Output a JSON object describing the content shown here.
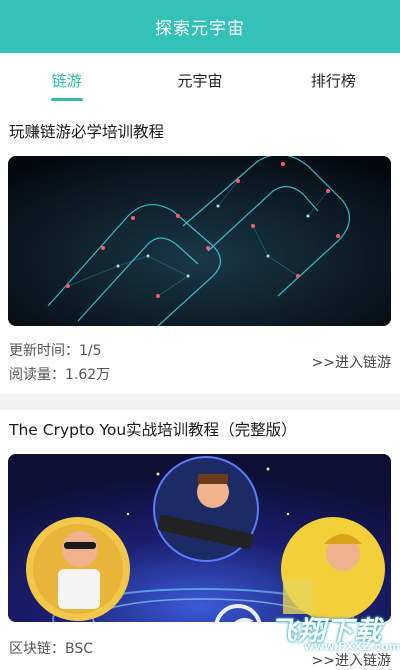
{
  "header": {
    "title": "探索元宇宙"
  },
  "tabs": [
    {
      "label": "链游",
      "active": true
    },
    {
      "label": "元宇宙",
      "active": false
    },
    {
      "label": "排行榜",
      "active": false
    }
  ],
  "cards": [
    {
      "title": "玩赚链游必学培训教程",
      "meta": [
        {
          "label": "更新时间：",
          "value": "1/5"
        },
        {
          "label": "阅读量：",
          "value": "1.62万"
        }
      ],
      "enter_label": ">>进入链游"
    },
    {
      "title": "The Crypto You实战培训教程（完整版）",
      "meta": [
        {
          "label": "区块链：",
          "value": "BSC"
        }
      ],
      "enter_label": ">>进入链游"
    }
  ],
  "watermark": {
    "text": "飞翔下载",
    "url": "www.FXXZ.com"
  },
  "colors": {
    "accent": "#34c1b7",
    "tab_active": "#2fbdb1",
    "separator": "#f2f2f2"
  }
}
